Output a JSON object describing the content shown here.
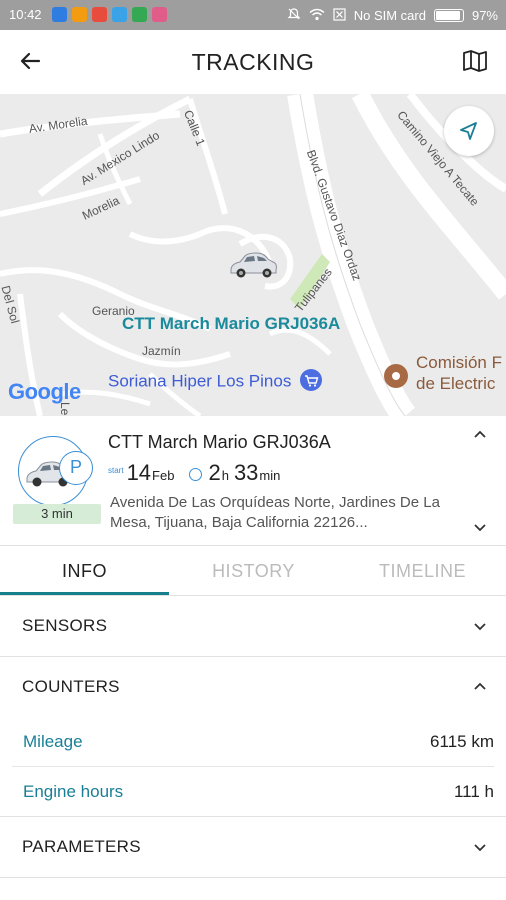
{
  "status_bar": {
    "time": "10:42",
    "carrier": "No SIM card",
    "battery": "97%",
    "battery_level": 0.97
  },
  "app_bar": {
    "title": "TRACKING",
    "back_icon": "arrow-left-icon",
    "map_icon": "map-icon"
  },
  "map": {
    "street_labels": [
      "Av. Morelia",
      "Av. Mexico Lindo",
      "Calle 1",
      "Morelia",
      "Blvd. Gustavo Diaz Ordaz",
      "Camino Viejo A Tecate",
      "Del Sol",
      "Geranio",
      "Jazmín",
      "Tulipanes",
      "Lec"
    ],
    "vehicle_label": "CTT March Mario GRJ036A",
    "poi_store": "Soriana Hiper Los Pinos",
    "poi_other_line1": "Comisión F",
    "poi_other_line2": "de Electric",
    "attribution": "Google",
    "locate_icon": "navigation-arrow-icon"
  },
  "vehicle_card": {
    "name": "CTT March Mario GRJ036A",
    "start_label": "start",
    "start_day": "14",
    "start_month": "Feb",
    "duration_hours": "2",
    "duration_hours_unit": "h",
    "duration_minutes": "33",
    "duration_minutes_unit": "min",
    "park_symbol": "P",
    "stop_duration": "3 min",
    "address": "Avenida De Las Orquídeas Norte, Jardines De La Mesa, Tijuana, Baja California 22126..."
  },
  "tabs": [
    {
      "label": "INFO",
      "active": true
    },
    {
      "label": "HISTORY",
      "active": false
    },
    {
      "label": "TIMELINE",
      "active": false
    }
  ],
  "sections": {
    "sensors": "SENSORS",
    "counters": "COUNTERS",
    "parameters": "PARAMETERS"
  },
  "counters": [
    {
      "label": "Mileage",
      "value": "6115 km"
    },
    {
      "label": "Engine hours",
      "value": "111 h"
    }
  ],
  "colors": {
    "accent": "#177f8c",
    "link_text": "#1a7f96",
    "card_ring": "#3a8fd6",
    "stop_badge": "#d6ecd6"
  }
}
